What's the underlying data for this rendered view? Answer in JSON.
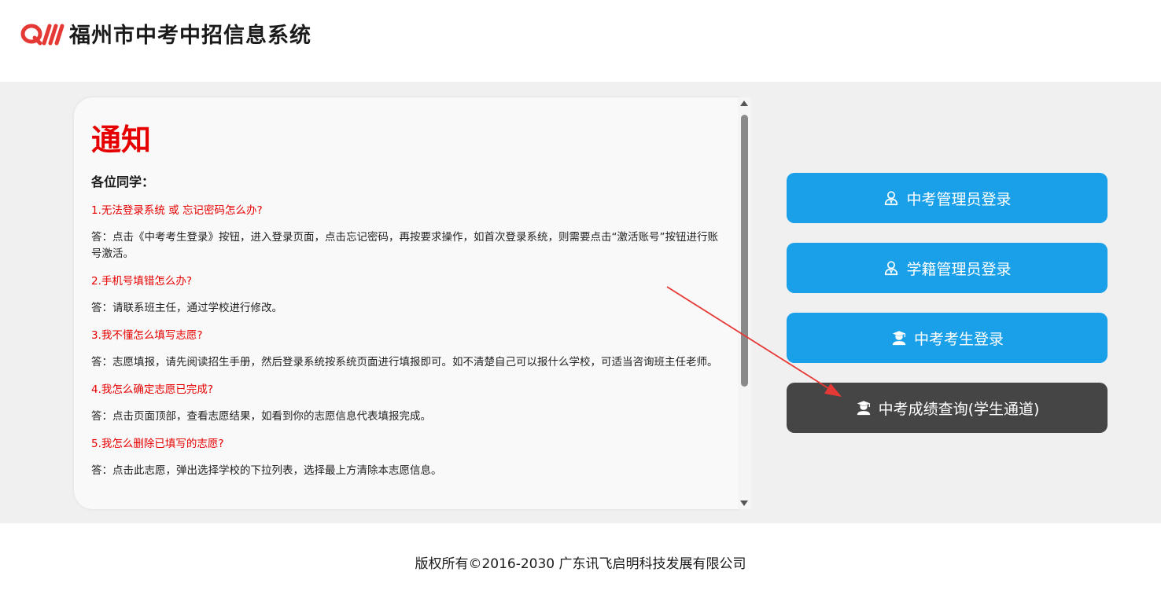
{
  "header": {
    "title": "福州市中考中招信息系统",
    "logo_icon": "qw-brand-logo"
  },
  "notice": {
    "title": "通知",
    "greeting": "各位同学：",
    "items": [
      {
        "q": "1.无法登录系统 或 忘记密码怎么办?",
        "a": "答：点击《中考考生登录》按钮，进入登录页面，点击忘记密码，再按要求操作，如首次登录系统，则需要点击“激活账号”按钮进行账号激活。"
      },
      {
        "q": "2.手机号填错怎么办?",
        "a": "答：请联系班主任，通过学校进行修改。"
      },
      {
        "q": "3.我不懂怎么填写志愿?",
        "a": "答：志愿填报，请先阅读招生手册，然后登录系统按系统页面进行填报即可。如不清楚自己可以报什么学校，可适当咨询班主任老师。"
      },
      {
        "q": "4.我怎么确定志愿已完成?",
        "a": "答：点击页面顶部，查看志愿结果，如看到你的志愿信息代表填报完成。"
      },
      {
        "q": "5.我怎么删除已填写的志愿?",
        "a": "答：点击此志愿，弹出选择学校的下拉列表，选择最上方清除本志愿信息。"
      }
    ]
  },
  "buttons": {
    "admin_login": "中考管理员登录",
    "registry_login": "学籍管理员登录",
    "student_login": "中考考生登录",
    "score_query": "中考成绩查询(学生通道)"
  },
  "icons": {
    "admin": "user-outline-icon",
    "student": "student-graduate-icon"
  },
  "colors": {
    "accent_blue": "#1aa0e8",
    "dark_button": "#454545",
    "notice_red": "#e60000",
    "annotation_arrow": "#e53935"
  },
  "footer": {
    "copyright": "版权所有©2016-2030 广东讯飞启明科技发展有限公司"
  }
}
